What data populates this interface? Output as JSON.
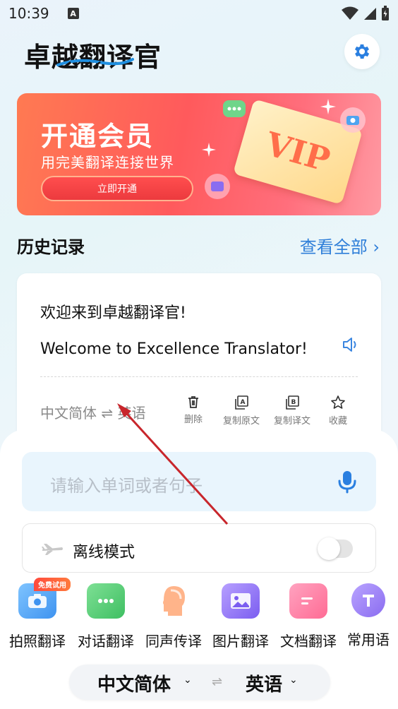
{
  "status": {
    "time": "10:39",
    "a_badge": "A"
  },
  "app": {
    "title": "卓越翻译官"
  },
  "banner": {
    "title": "开通会员",
    "subtitle": "用完美翻译连接世界",
    "button": "立即开通",
    "vip": "VIP"
  },
  "history": {
    "title": "历史记录",
    "view_all": "查看全部 ›",
    "item": {
      "source": "欢迎来到卓越翻译官!",
      "target": "Welcome to Excellence Translator!",
      "lang_pair": "中文简体 ⇌ 英语",
      "actions": [
        "删除",
        "复制原文",
        "复制译文",
        "收藏"
      ]
    }
  },
  "input": {
    "placeholder": "请输入单词或者句子"
  },
  "offline": {
    "label": "离线模式",
    "enabled": false
  },
  "features": {
    "badge": "免费试用",
    "items": [
      "拍照翻译",
      "对话翻译",
      "同声传译",
      "图片翻译",
      "文档翻译",
      "常用语"
    ]
  },
  "lang_bar": {
    "source": "中文简体",
    "target": "英语",
    "swap": "⇌"
  },
  "colors": {
    "accent": "#2f7fd9",
    "banner": "#ff5a5c",
    "arrow": "#c8262c"
  }
}
